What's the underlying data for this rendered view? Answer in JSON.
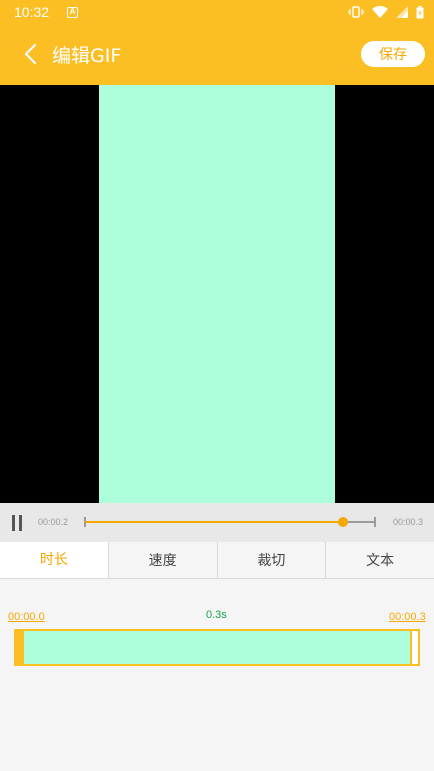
{
  "status_bar": {
    "time": "10:32",
    "notification_icon": "a-icon",
    "icons": [
      "vibrate-icon",
      "wifi-icon",
      "signal-icon",
      "battery-icon"
    ]
  },
  "app_bar": {
    "title": "编辑GIF",
    "save_label": "保存"
  },
  "playback": {
    "current_time": "00:00.2",
    "total_time": "00:00.3",
    "progress": 0.89
  },
  "tabs": [
    {
      "label": "时长",
      "active": true
    },
    {
      "label": "速度",
      "active": false
    },
    {
      "label": "裁切",
      "active": false
    },
    {
      "label": "文本",
      "active": false
    }
  ],
  "timeline": {
    "start_time": "00:00.0",
    "end_time": "00:00.3",
    "duration": "0.3s"
  },
  "colors": {
    "accent": "#fbbf24",
    "accent_text": "#f5a800",
    "frame": "#adfedb",
    "duration_text": "#16a34a"
  }
}
